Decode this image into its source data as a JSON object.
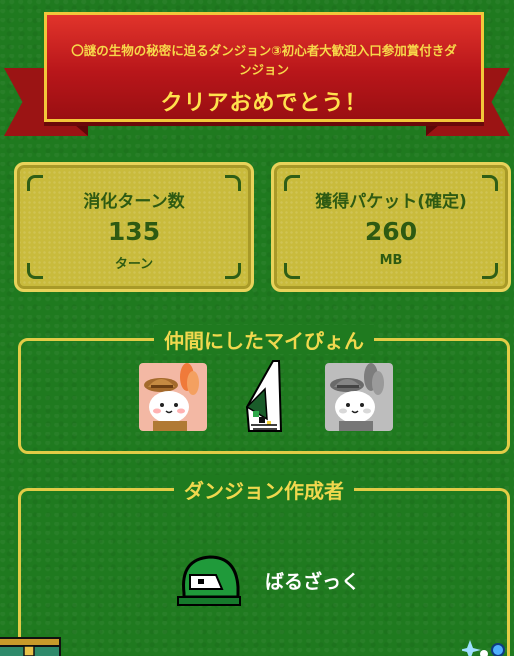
{
  "banner": {
    "subtitle": "〇謎の生物の秘密に迫るダンジョン③初心者大歓迎入口参加賞付きダンジョン",
    "title": "クリアおめでとう！"
  },
  "stats": {
    "turns": {
      "label": "消化ターン数",
      "value": "135",
      "unit": "ターン"
    },
    "packets": {
      "label": "獲得パケット(確定)",
      "value": "260",
      "unit": "MB"
    }
  },
  "party": {
    "title": "仲間にしたマイぴょん",
    "members": [
      {
        "icon": "explorer-bunny-orange-ears-icon",
        "colors": {
          "background": "#f3b8a4",
          "ears": "#f07a3a"
        }
      },
      {
        "icon": "book-item-icon"
      },
      {
        "icon": "explorer-bunny-gray-ears-icon",
        "colors": {
          "background": "#bdbdbd",
          "ears": "#8a8a8a"
        }
      }
    ]
  },
  "creator": {
    "title": "ダンジョン作成者",
    "name": "ばるざっく",
    "avatar_icon": "green-cap-avatar-icon"
  },
  "colors": {
    "background": "#1f7a1f",
    "gold": "#e2cc46",
    "ribbon_red": "#c41e1e",
    "stat_box": "#c9bb3c",
    "stat_text": "#2e5a12"
  }
}
